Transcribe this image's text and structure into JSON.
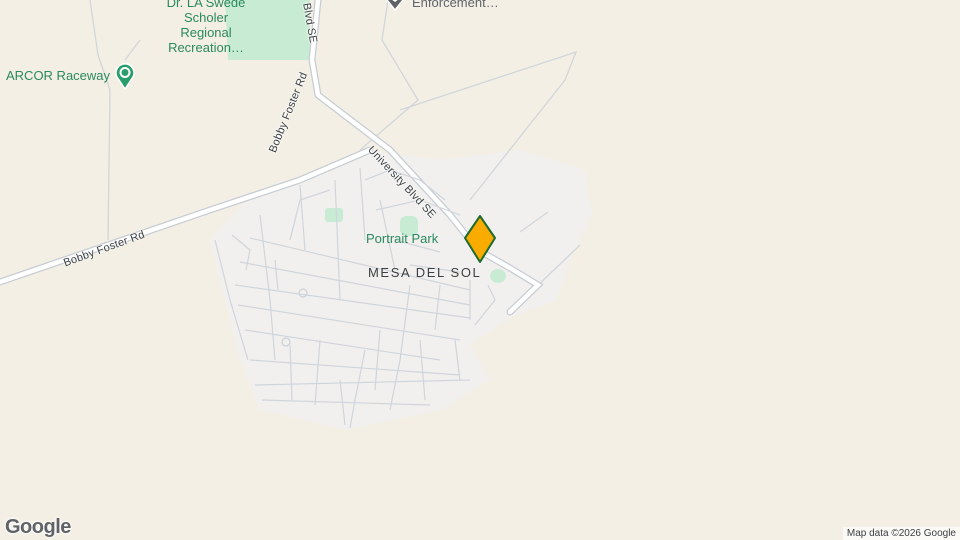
{
  "pois": {
    "park_name_line1": "Dr. LA Swede",
    "park_name_line2": "Scholer",
    "park_name_line3": "Regional",
    "park_name_line4": "Recreation…",
    "raceway": "ARCOR Raceway",
    "enforcement": "Enforcement…",
    "portrait_park": "Portrait Park"
  },
  "roads": {
    "bobby_foster_upper": "Bobby Foster Rd",
    "bobby_foster_lower": "Bobby Foster Rd",
    "university_blvd": "University Blvd SE",
    "blvd_se_top": "Blvd SE"
  },
  "areas": {
    "mesa_del_sol": "MESA DEL SOL"
  },
  "marker": {
    "color": "#F9AB00",
    "stroke": "#1e6b2e",
    "icon": "map-pin-marker"
  },
  "footer": {
    "logo": "Google",
    "attribution": "Map data ©2026 Google"
  },
  "colors": {
    "land": "#f3efe4",
    "urban": "#f1f0ee",
    "park": "#c8ecd3",
    "road": "#ffffff",
    "road_outline": "#c6ccd3"
  }
}
